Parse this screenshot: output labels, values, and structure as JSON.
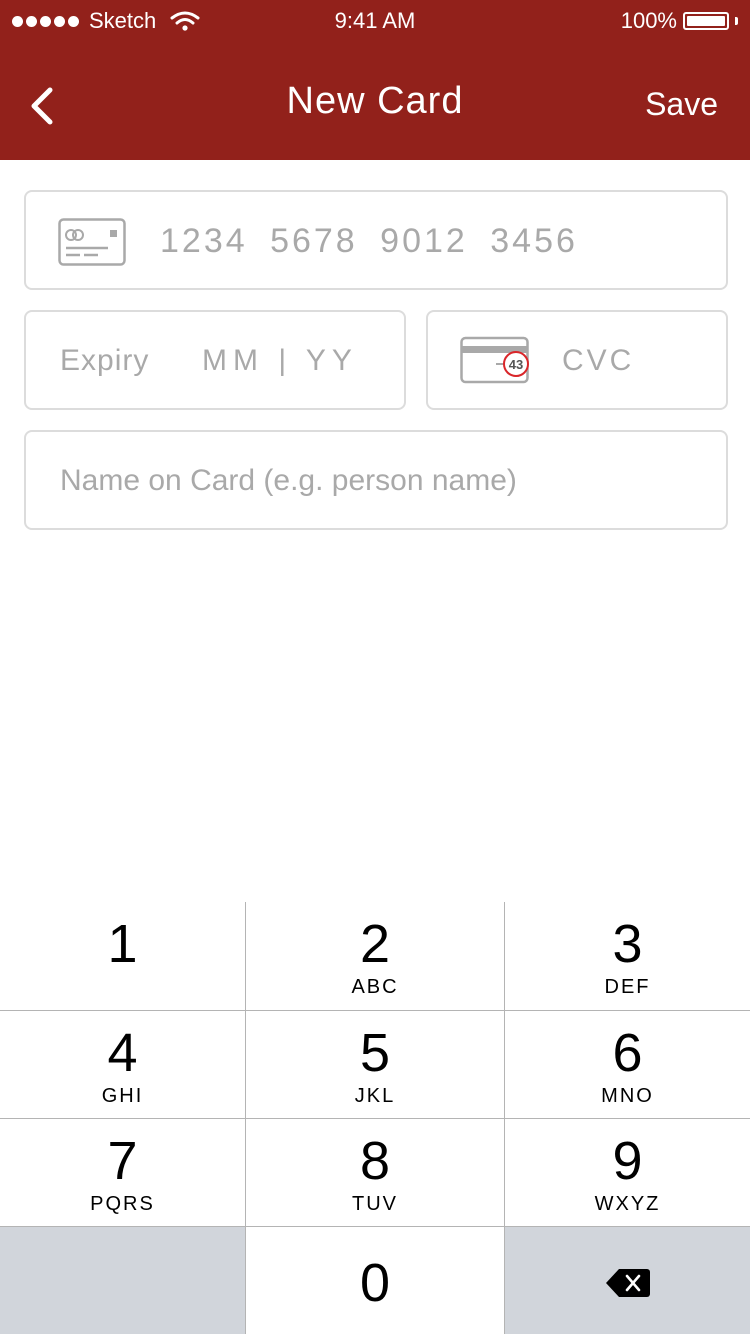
{
  "status_bar": {
    "carrier": "Sketch",
    "time": "9:41 AM",
    "battery": "100%"
  },
  "nav": {
    "title": "New Card",
    "save_label": "Save"
  },
  "form": {
    "card_number_placeholder": "1234 5678 9012 3456",
    "expiry_label": "Expiry",
    "expiry_placeholder": "MM | YY",
    "cvc_placeholder": "CVC",
    "cvc_icon_number": "43",
    "name_placeholder": "Name on Card (e.g. person name)"
  },
  "keypad": {
    "keys": [
      {
        "digit": "1",
        "letters": ""
      },
      {
        "digit": "2",
        "letters": "ABC"
      },
      {
        "digit": "3",
        "letters": "DEF"
      },
      {
        "digit": "4",
        "letters": "GHI"
      },
      {
        "digit": "5",
        "letters": "JKL"
      },
      {
        "digit": "6",
        "letters": "MNO"
      },
      {
        "digit": "7",
        "letters": "PQRS"
      },
      {
        "digit": "8",
        "letters": "TUV"
      },
      {
        "digit": "9",
        "letters": "WXYZ"
      },
      {
        "digit": "0",
        "letters": ""
      }
    ]
  },
  "colors": {
    "header_bg": "#92211b",
    "field_border": "#dcdcdc",
    "placeholder": "#a9a9a9",
    "keypad_gray": "#d1d5db",
    "cvc_circle": "#d9262a"
  },
  "icons": [
    "back-chevron-icon",
    "credit-card-icon",
    "cvc-card-icon",
    "wifi-icon",
    "battery-icon",
    "delete-backspace-icon"
  ]
}
